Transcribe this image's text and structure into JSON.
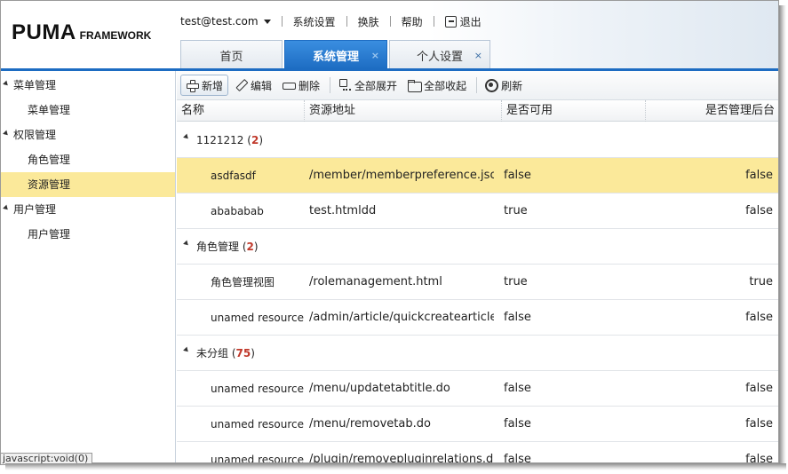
{
  "logo": {
    "main": "PUMA",
    "sub": "FRAMEWORK"
  },
  "topnav": {
    "user": "test@test.com",
    "items": [
      "系统设置",
      "换肤",
      "帮助"
    ],
    "logout": "退出"
  },
  "tabs": [
    {
      "label": "首页",
      "closable": false,
      "active": false
    },
    {
      "label": "系统管理",
      "closable": true,
      "active": true
    },
    {
      "label": "个人设置",
      "closable": true,
      "active": false
    }
  ],
  "close_glyph": "×",
  "sidebar": {
    "items": [
      {
        "label": "菜单管理",
        "level": 1
      },
      {
        "label": "菜单管理",
        "level": 2
      },
      {
        "label": "权限管理",
        "level": 1
      },
      {
        "label": "角色管理",
        "level": 2
      },
      {
        "label": "资源管理",
        "level": 2,
        "selected": true
      },
      {
        "label": "用户管理",
        "level": 1
      },
      {
        "label": "用户管理",
        "level": 2
      }
    ]
  },
  "status_tip": "javascript:void(0)",
  "toolbar": {
    "add": "新增",
    "edit": "编辑",
    "delete": "删除",
    "expand_all": "全部展开",
    "collapse_all": "全部收起",
    "refresh": "刷新"
  },
  "grid": {
    "columns": [
      "名称",
      "资源地址",
      "是否可用",
      "是否管理后台"
    ],
    "groups": [
      {
        "name": "1121212",
        "count": "2",
        "rows": [
          {
            "name": "asdfasdf",
            "url": "/member/memberpreference.json",
            "enabled": "false",
            "admin": "false",
            "selected": true
          },
          {
            "name": "abababab",
            "url": "test.htmldd",
            "enabled": "true",
            "admin": "false"
          }
        ]
      },
      {
        "name": "角色管理",
        "count": "2",
        "rows": [
          {
            "name": "角色管理视图",
            "url": "/rolemanagement.html",
            "enabled": "true",
            "admin": "true"
          },
          {
            "name": "unamed resource",
            "url": "/admin/article/quickcreatearticle.do",
            "enabled": "false",
            "admin": "false"
          }
        ]
      },
      {
        "name": "未分组",
        "count": "75",
        "rows": [
          {
            "name": "unamed resource",
            "url": "/menu/updatetabtitle.do",
            "enabled": "false",
            "admin": "false"
          },
          {
            "name": "unamed resource",
            "url": "/menu/removetab.do",
            "enabled": "false",
            "admin": "false"
          },
          {
            "name": "unamed resource",
            "url": "/plugin/removepluginrelations.do",
            "enabled": "false",
            "admin": "false"
          }
        ]
      }
    ]
  }
}
